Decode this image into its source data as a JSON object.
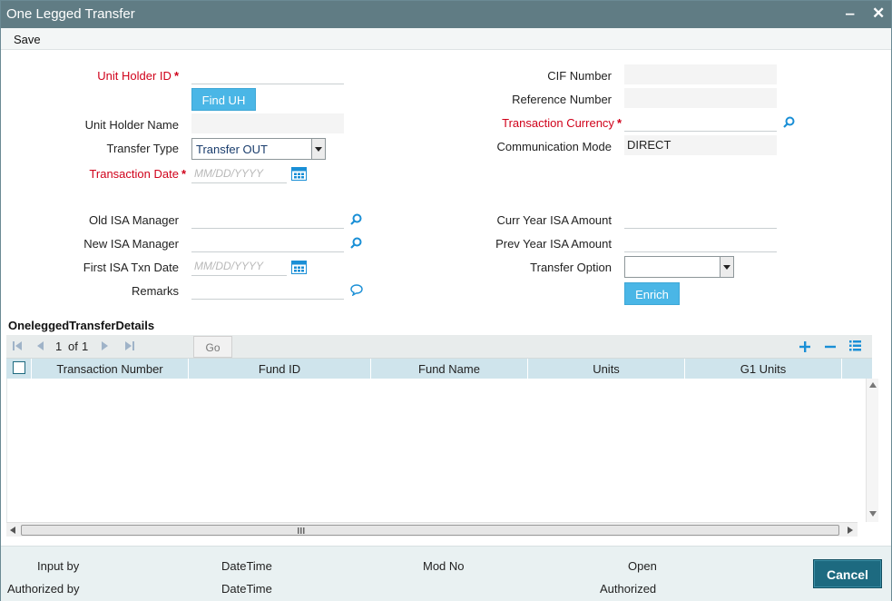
{
  "window": {
    "title": "One Legged Transfer",
    "minimize_glyph": "‒",
    "close_glyph": "✕"
  },
  "menu": {
    "save_label": "Save"
  },
  "form": {
    "unit_holder_id": {
      "label": "Unit Holder ID",
      "value": ""
    },
    "find_uh_label": "Find UH",
    "unit_holder_name": {
      "label": "Unit Holder Name",
      "value": ""
    },
    "transfer_type": {
      "label": "Transfer Type",
      "value": "Transfer OUT"
    },
    "transaction_date": {
      "label": "Transaction Date",
      "placeholder": "MM/DD/YYYY"
    },
    "cif_number": {
      "label": "CIF Number",
      "value": ""
    },
    "reference_number": {
      "label": "Reference Number",
      "value": ""
    },
    "transaction_currency": {
      "label": "Transaction Currency",
      "value": ""
    },
    "communication_mode": {
      "label": "Communication Mode",
      "value": "DIRECT"
    },
    "old_isa_manager": {
      "label": "Old ISA Manager",
      "value": ""
    },
    "new_isa_manager": {
      "label": "New ISA Manager",
      "value": ""
    },
    "first_isa_txn_date": {
      "label": "First ISA Txn Date",
      "placeholder": "MM/DD/YYYY"
    },
    "remarks": {
      "label": "Remarks",
      "value": ""
    },
    "curr_year_isa_amount": {
      "label": "Curr Year ISA Amount",
      "value": ""
    },
    "prev_year_isa_amount": {
      "label": "Prev Year ISA Amount",
      "value": ""
    },
    "transfer_option": {
      "label": "Transfer Option",
      "value": ""
    },
    "enrich_label": "Enrich",
    "required_mark": "*"
  },
  "grid": {
    "section_title": "OneleggedTransferDetails",
    "pager": {
      "current": "1",
      "of_label": "of",
      "total": "1"
    },
    "go_label": "Go",
    "columns": [
      "Transaction Number",
      "Fund ID",
      "Fund Name",
      "Units",
      "G1 Units"
    ],
    "rows": []
  },
  "footer": {
    "input_by": "Input by",
    "authorized_by": "Authorized by",
    "datetime_1": "DateTime",
    "datetime_2": "DateTime",
    "mod_no": "Mod No",
    "open": "Open",
    "authorized": "Authorized",
    "cancel_label": "Cancel"
  },
  "colors": {
    "title_bar": "#607c84",
    "accent_blue": "#4ab6e6",
    "required_red": "#d0021b",
    "icon_blue": "#1a8fd6",
    "cancel_bg": "#1d6a80"
  },
  "icons": [
    "search-icon",
    "calendar-icon",
    "comment-icon",
    "add-icon",
    "remove-icon",
    "list-icon",
    "first-page-icon",
    "prev-page-icon",
    "next-page-icon",
    "last-page-icon"
  ]
}
